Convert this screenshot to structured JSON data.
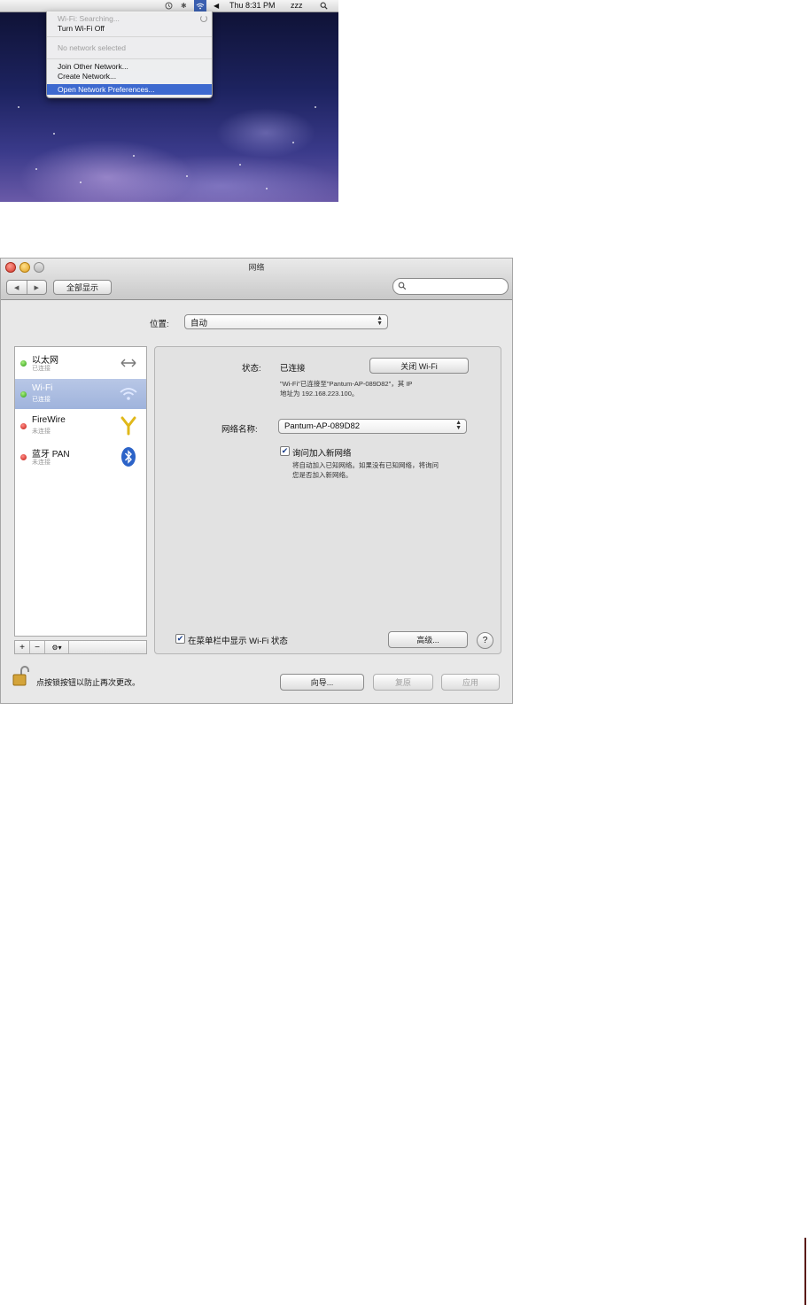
{
  "menu_bar": {
    "clock": "Thu 8:31 PM",
    "user": "zzz"
  },
  "wifi_menu": {
    "status": "Wi-Fi: Searching...",
    "turn_off": "Turn Wi-Fi Off",
    "no_network": "No network selected",
    "join_other": "Join Other Network...",
    "create_network": "Create Network...",
    "open_prefs": "Open Network Preferences..."
  },
  "window": {
    "title": "网络",
    "show_all": "全部显示",
    "location_label": "位置:",
    "location_value": "自动"
  },
  "services": [
    {
      "name": "以太网",
      "status": "已连接",
      "status_color": "green",
      "icon": "ethernet-icon"
    },
    {
      "name": "Wi-Fi",
      "status": "已连接",
      "status_color": "green",
      "icon": "wifi-icon",
      "selected": true
    },
    {
      "name": "FireWire",
      "status": "未连接",
      "status_color": "red",
      "icon": "firewire-icon"
    },
    {
      "name": "蓝牙 PAN",
      "status": "未连接",
      "status_color": "red",
      "icon": "bluetooth-icon"
    }
  ],
  "detail": {
    "status_label": "状态:",
    "status_value": "已连接",
    "turn_off_wifi": "关闭 Wi-Fi",
    "status_desc_line1": "\"Wi-Fi\"已连接至\"Pantum-AP-089D82\"，其 IP",
    "status_desc_line2": "地址为 192.168.223.100。",
    "network_name_label": "网络名称:",
    "network_name_value": "Pantum-AP-089D82",
    "ask_join_label": "询问加入新网络",
    "ask_join_checked": true,
    "ask_join_desc_line1": "将自动加入已知网络。如果没有已知网络，将询问",
    "ask_join_desc_line2": "您是否加入新网络。",
    "show_in_menubar_label": "在菜单栏中显示 Wi-Fi 状态",
    "show_in_menubar_checked": true,
    "advanced": "高级...",
    "help": "?"
  },
  "footer": {
    "lock_text": "点按锁按钮以防止再次更改。",
    "assist": "向导...",
    "revert": "复原",
    "apply": "应用"
  },
  "colors": {
    "highlight": "#3d69cf",
    "selection": "#9fb3dc",
    "connected": "#2a9a12",
    "disconnected": "#c0180f"
  }
}
